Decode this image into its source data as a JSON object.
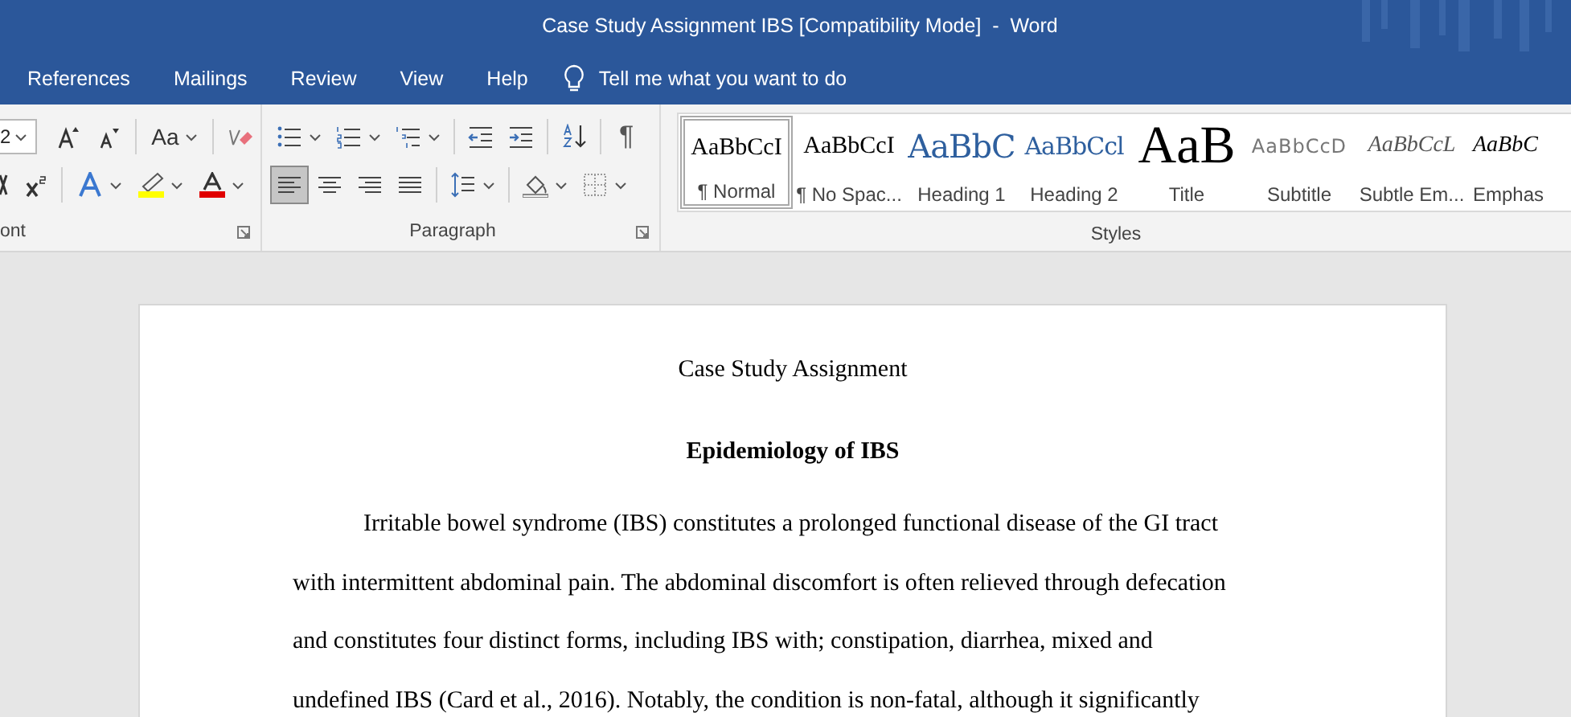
{
  "window": {
    "title": "Case Study Assignment IBS [Compatibility Mode]  -  Word"
  },
  "menu_tabs": [
    {
      "label": "References"
    },
    {
      "label": "Mailings"
    },
    {
      "label": "Review"
    },
    {
      "label": "View"
    },
    {
      "label": "Help"
    }
  ],
  "tell_me": "Tell me what you want to do",
  "font_group": {
    "font_size": "2",
    "change_case": "Aa",
    "label": "ont"
  },
  "paragraph_group": {
    "alignments": [
      {
        "selected": true
      },
      {
        "selected": false
      },
      {
        "selected": false
      },
      {
        "selected": false
      }
    ],
    "show_marks": "¶",
    "label": "Paragraph"
  },
  "styles_group": {
    "label": "Styles",
    "items": [
      {
        "preview": "AaBbCcI",
        "name": "¶ Normal",
        "kind": "normal",
        "selected": true
      },
      {
        "preview": "AaBbCcI",
        "name": "¶ No Spac...",
        "kind": "no-spacing",
        "selected": false
      },
      {
        "preview": "AaBbC",
        "name": "Heading 1",
        "kind": "heading1",
        "selected": false
      },
      {
        "preview": "AaBbCcl",
        "name": "Heading 2",
        "kind": "heading2",
        "selected": false
      },
      {
        "preview": "AaB",
        "name": "Title",
        "kind": "title",
        "selected": false
      },
      {
        "preview": "AaBbCcD",
        "name": "Subtitle",
        "kind": "subtitle",
        "selected": false
      },
      {
        "preview": "AaBbCcL",
        "name": "Subtle Em...",
        "kind": "subtle-emphasis",
        "selected": false
      },
      {
        "preview": "AaBbC",
        "name": "Emphas",
        "kind": "emphasis",
        "selected": false
      }
    ]
  },
  "document": {
    "title": "Case Study Assignment",
    "heading": "Epidemiology of IBS",
    "paragraph_lines": [
      "Irritable bowel syndrome (IBS) constitutes a prolonged functional disease of the GI tract",
      "with intermittent abdominal pain. The abdominal discomfort is often relieved through defecation",
      "and constitutes four distinct forms, including IBS with; constipation, diarrhea, mixed and",
      "undefined IBS (Card et al., 2016). Notably, the condition is non-fatal, although it significantly"
    ]
  }
}
